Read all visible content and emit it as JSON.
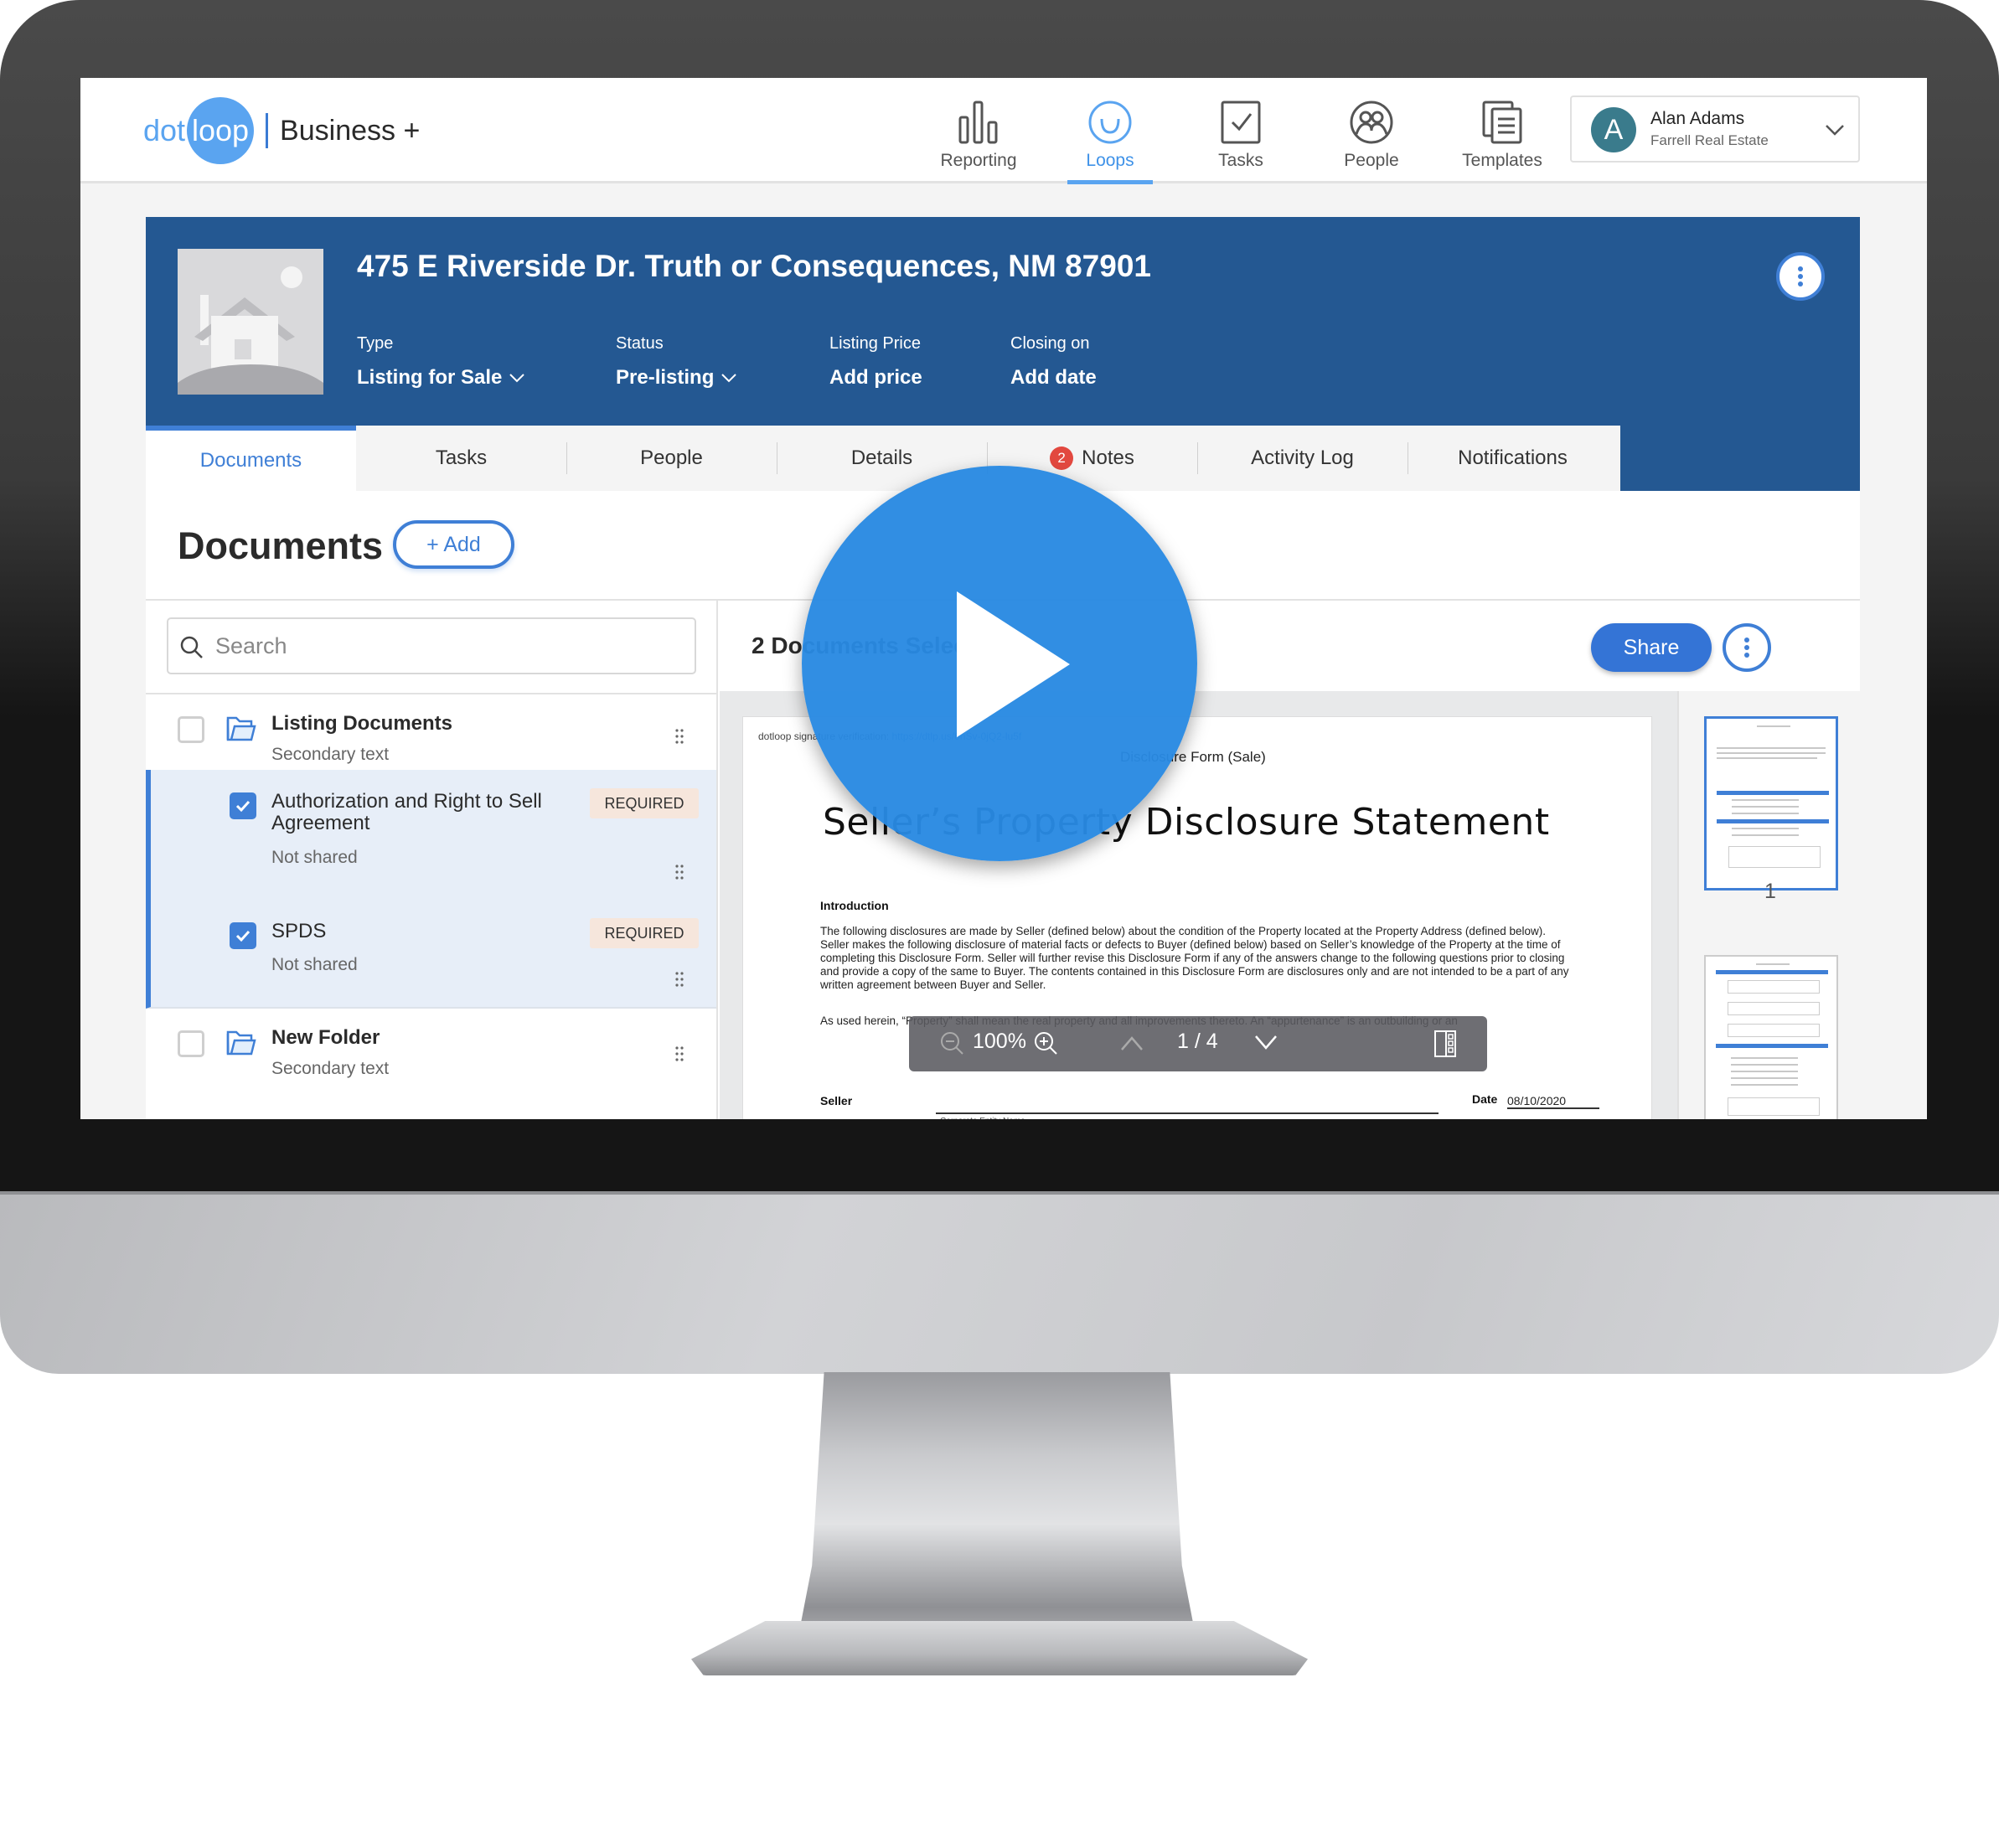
{
  "app": {
    "logo_dot": "dot",
    "logo_loop": "loop",
    "plan": "Business +"
  },
  "nav": {
    "items": [
      {
        "label": "Reporting",
        "icon": "bar-chart-icon",
        "active": false
      },
      {
        "label": "Loops",
        "icon": "loop-smile-icon",
        "active": true
      },
      {
        "label": "Tasks",
        "icon": "checkbox-icon",
        "active": false
      },
      {
        "label": "People",
        "icon": "people-icon",
        "active": false
      },
      {
        "label": "Templates",
        "icon": "templates-icon",
        "active": false
      }
    ]
  },
  "user": {
    "initial": "A",
    "name": "Alan Adams",
    "organization": "Farrell Real Estate"
  },
  "loop": {
    "address": "475 E Riverside Dr. Truth or Consequences, NM 87901",
    "fields": [
      {
        "label": "Type",
        "value": "Listing for Sale",
        "dropdown": true
      },
      {
        "label": "Status",
        "value": "Pre-listing",
        "dropdown": true
      },
      {
        "label": "Listing Price",
        "value": "Add price",
        "dropdown": false
      },
      {
        "label": "Closing on",
        "value": "Add date",
        "dropdown": false
      }
    ]
  },
  "tabs": [
    {
      "label": "Documents",
      "active": true
    },
    {
      "label": "Tasks"
    },
    {
      "label": "People"
    },
    {
      "label": "Details"
    },
    {
      "label": "Notes",
      "badge": "2"
    },
    {
      "label": "Activity Log"
    },
    {
      "label": "Notifications"
    }
  ],
  "documents": {
    "title": "Documents",
    "add_label": "+ Add",
    "search_placeholder": "Search",
    "items": [
      {
        "type": "folder",
        "title": "Listing Documents",
        "subtitle": "Secondary text",
        "checked": false
      },
      {
        "type": "document",
        "title": "Authorization and Right to Sell Agreement",
        "subtitle": "Not shared",
        "checked": true,
        "badge": "REQUIRED"
      },
      {
        "type": "document",
        "title": "SPDS",
        "subtitle": "Not shared",
        "checked": true,
        "badge": "REQUIRED"
      },
      {
        "type": "folder",
        "title": "New Folder",
        "subtitle": "Secondary text",
        "checked": false
      }
    ],
    "selected_count_label": "2 Documents Selected",
    "share_label": "Share"
  },
  "viewer": {
    "verification_prefix": "dotloop signature verification:",
    "verification_link": "https://dtlp.us/6nSv-0jQ2-lu5f",
    "form_name": "Disclosure Form (Sale)",
    "doc_title": "Seller’s Property Disclosure Statement",
    "intro_heading": "Introduction",
    "intro_body": "The following disclosures are made by Seller (defined below) about the condition of the Property located at the Property Address (defined below). Seller makes the following disclosure of material facts or defects to Buyer (defined below) based on Seller’s knowledge of the Property at the time of completing this Disclosure Form. Seller will further revise this Disclosure Form if any of the answers change to the following questions prior to closing and provide a copy of the same to Buyer. The contents contained in this Disclosure Form are disclosures only and are not intended to be a part of any written agreement between Buyer and Seller.",
    "used_herein_body": "As used herein, “Property” shall mean the real property and all improvements thereto. An “appurtenance” is an outbuilding or an",
    "seller_label": "Seller",
    "entity_label": "Corporate Entity Name",
    "date_label": "Date",
    "date_value": "08/10/2020",
    "zoom_level": "100%",
    "current_page": "1 / 4",
    "thumbnail_page": "1"
  },
  "overlay": {
    "play_button": "play-video"
  }
}
